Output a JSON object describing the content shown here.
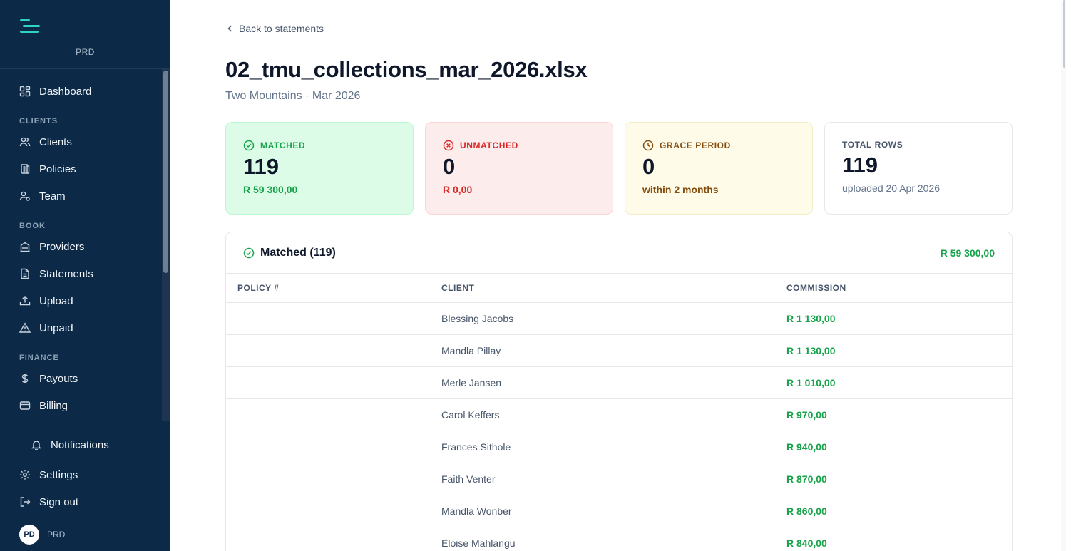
{
  "sidebar": {
    "brand": "PRD",
    "items": {
      "dashboard": "Dashboard",
      "section_clients": "CLIENTS",
      "clients": "Clients",
      "policies": "Policies",
      "team": "Team",
      "section_book": "BOOK",
      "providers": "Providers",
      "statements": "Statements",
      "upload": "Upload",
      "unpaid": "Unpaid",
      "section_finance": "FINANCE",
      "payouts": "Payouts",
      "billing": "Billing"
    },
    "bottom": {
      "notifications": "Notifications",
      "settings": "Settings",
      "sign_out": "Sign out"
    },
    "user": {
      "initials": "PD",
      "name": "PRD"
    }
  },
  "header": {
    "back_label": "Back to statements",
    "title": "02_tmu_collections_mar_2026.xlsx",
    "subtitle": "Two Mountains · Mar 2026"
  },
  "stats": {
    "matched": {
      "label": "MATCHED",
      "value": "119",
      "sub": "R 59 300,00"
    },
    "unmatched": {
      "label": "UNMATCHED",
      "value": "0",
      "sub": "R 0,00"
    },
    "grace": {
      "label": "GRACE PERIOD",
      "value": "0",
      "sub": "within 2 months"
    },
    "total": {
      "label": "TOTAL ROWS",
      "value": "119",
      "sub": "uploaded 20 Apr 2026"
    }
  },
  "table": {
    "title": "Matched (119)",
    "total": "R 59 300,00",
    "columns": [
      "POLICY #",
      "CLIENT",
      "COMMISSION"
    ],
    "rows": [
      {
        "policy": "",
        "client": "Blessing Jacobs",
        "commission": "R 1 130,00"
      },
      {
        "policy": "",
        "client": "Mandla Pillay",
        "commission": "R 1 130,00"
      },
      {
        "policy": "",
        "client": "Merle Jansen",
        "commission": "R 1 010,00"
      },
      {
        "policy": "",
        "client": "Carol Keffers",
        "commission": "R 970,00"
      },
      {
        "policy": "",
        "client": "Frances Sithole",
        "commission": "R 940,00"
      },
      {
        "policy": "",
        "client": "Faith Venter",
        "commission": "R 870,00"
      },
      {
        "policy": "",
        "client": "Mandla Wonber",
        "commission": "R 860,00"
      },
      {
        "policy": "",
        "client": "Eloise Mahlangu",
        "commission": "R 840,00"
      }
    ]
  },
  "colors": {
    "sidebar_bg": "#0c2a47",
    "accent_teal": "#2dd4bf",
    "matched_green": "#16a34a",
    "unmatched_red": "#dc2626",
    "grace_brown": "#854d0e"
  }
}
